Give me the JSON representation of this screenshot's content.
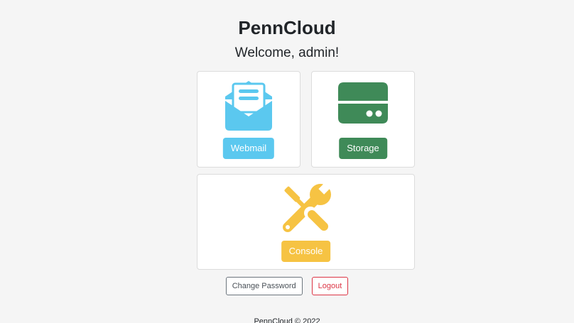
{
  "header": {
    "brand": "PennCloud",
    "welcome": "Welcome, admin!"
  },
  "apps": {
    "webmail": {
      "label": "Webmail",
      "icon": "envelope-open-icon",
      "color": "#5bc8ef"
    },
    "storage": {
      "label": "Storage",
      "icon": "server-icon",
      "color": "#3f8a58"
    },
    "console": {
      "label": "Console",
      "icon": "tools-icon",
      "color": "#f6c343"
    }
  },
  "account": {
    "change_password_label": "Change Password",
    "logout_label": "Logout"
  },
  "footer": {
    "text": "PennCloud © 2022"
  }
}
